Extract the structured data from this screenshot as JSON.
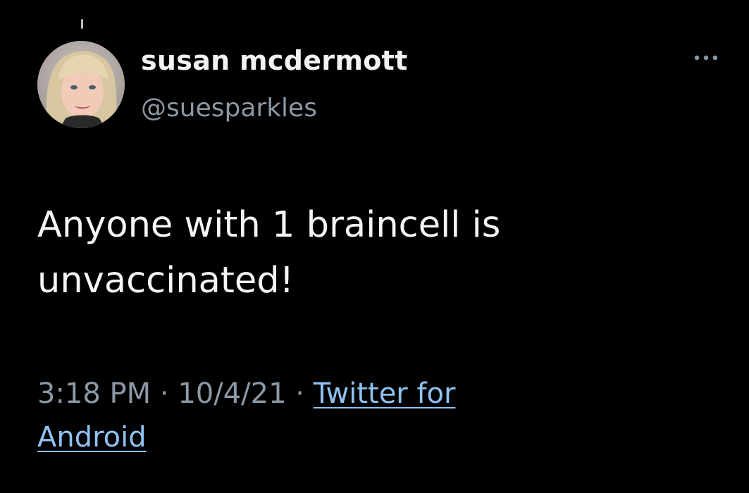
{
  "tweet": {
    "display_name": "susan mcdermott",
    "handle": "@suesparkles",
    "text_lines": [
      "Anyone with 1 braincell is",
      "unvaccinated!"
    ],
    "time": "3:18 PM",
    "separator": "·",
    "date": "10/4/21",
    "source_line1": "Twitter for",
    "source_line2": "Android",
    "more_icon": "more-horizontal-icon"
  },
  "colors": {
    "background": "#000000",
    "primary_text": "#f5f5f5",
    "secondary_text": "#8b98a5",
    "link": "#8fc2f0"
  }
}
